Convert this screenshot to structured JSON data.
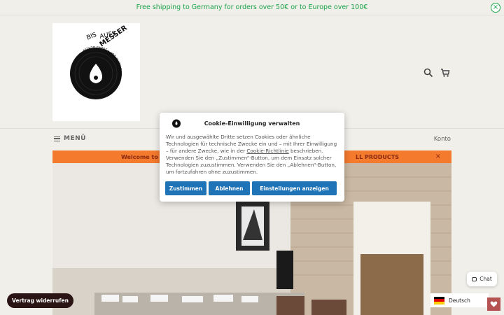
{
  "announcement": {
    "text": "Free shipping to Germany for orders over 50€ or to Europe over 100€",
    "close_icon": "close-circle-icon",
    "color": "#1aa34a"
  },
  "logo": {
    "text_top": "BIS AUFS MESSER",
    "text_ring": "RECORDSTORE & MAILORDER • MARCHLEWSKISTR. 107 • 10243 BERLIN"
  },
  "header": {
    "search_icon": "search-icon",
    "cart_icon": "cart-icon"
  },
  "nav": {
    "menu_label": "MENÜ",
    "account_label": "Konto"
  },
  "promo": {
    "text_left": "Welcome to B",
    "text_right": "LL PRODUCTS",
    "close": "×",
    "color": "#f47a2e"
  },
  "cookie_dialog": {
    "title": "Cookie-Einwilligung verwalten",
    "body_1": "Wir und ausgewählte Dritte setzen Cookies oder ähnliche Technologien für technische Zwecke ein und – mit Ihrer Einwilligung – für andere Zwecke, wie in der",
    "link": "Cookie-Richtlinie",
    "body_2": "beschrieben. Verwenden Sie den „Zustimmen“-Button, um dem Einsatz solcher Technologien zuzustimmen. Verwenden Sie den „Ablehnen“-Button, um fortzufahren ohne zuzustimmen.",
    "accept": "Zustimmen",
    "reject": "Ablehnen",
    "settings": "Einstellungen anzeigen",
    "button_color": "#1e74b7"
  },
  "withdraw_button": "Vertrag widerrufen",
  "chat_button": "Chat",
  "language": {
    "selected": "Deutsch",
    "flag_icon": "german-flag-icon"
  },
  "wishlist_icon": "heart-icon"
}
